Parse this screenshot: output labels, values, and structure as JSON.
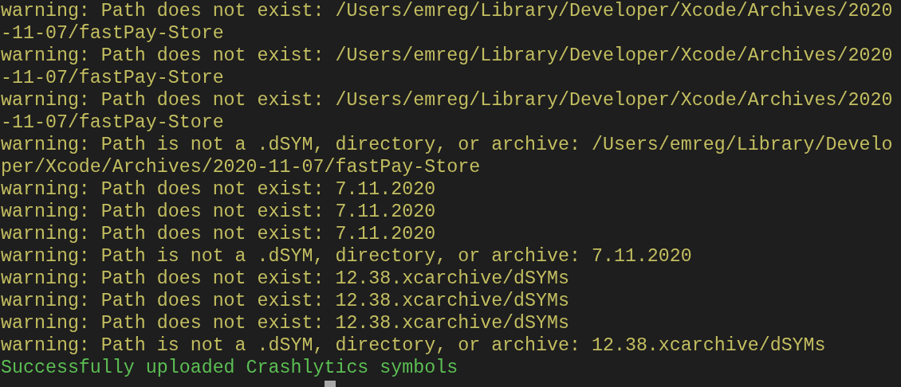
{
  "terminal": {
    "lines": [
      {
        "kind": "warning",
        "text": "warning: Path does not exist: /Users/emreg/Library/Developer/Xcode/Archives/2020"
      },
      {
        "kind": "warning",
        "text": "-11-07/fastPay-Store"
      },
      {
        "kind": "warning",
        "text": "warning: Path does not exist: /Users/emreg/Library/Developer/Xcode/Archives/2020"
      },
      {
        "kind": "warning",
        "text": "-11-07/fastPay-Store"
      },
      {
        "kind": "warning",
        "text": "warning: Path does not exist: /Users/emreg/Library/Developer/Xcode/Archives/2020"
      },
      {
        "kind": "warning",
        "text": "-11-07/fastPay-Store"
      },
      {
        "kind": "warning",
        "text": "warning: Path is not a .dSYM, directory, or archive: /Users/emreg/Library/Develo"
      },
      {
        "kind": "warning",
        "text": "per/Xcode/Archives/2020-11-07/fastPay-Store"
      },
      {
        "kind": "warning",
        "text": "warning: Path does not exist: 7.11.2020"
      },
      {
        "kind": "warning",
        "text": "warning: Path does not exist: 7.11.2020"
      },
      {
        "kind": "warning",
        "text": "warning: Path does not exist: 7.11.2020"
      },
      {
        "kind": "warning",
        "text": "warning: Path is not a .dSYM, directory, or archive: 7.11.2020"
      },
      {
        "kind": "warning",
        "text": "warning: Path does not exist: 12.38.xcarchive/dSYMs"
      },
      {
        "kind": "warning",
        "text": "warning: Path does not exist: 12.38.xcarchive/dSYMs"
      },
      {
        "kind": "warning",
        "text": "warning: Path does not exist: 12.38.xcarchive/dSYMs"
      },
      {
        "kind": "warning",
        "text": "warning: Path is not a .dSYM, directory, or archive: 12.38.xcarchive/dSYMs"
      },
      {
        "kind": "success",
        "text": "Successfully uploaded Crashlytics symbols"
      }
    ]
  }
}
